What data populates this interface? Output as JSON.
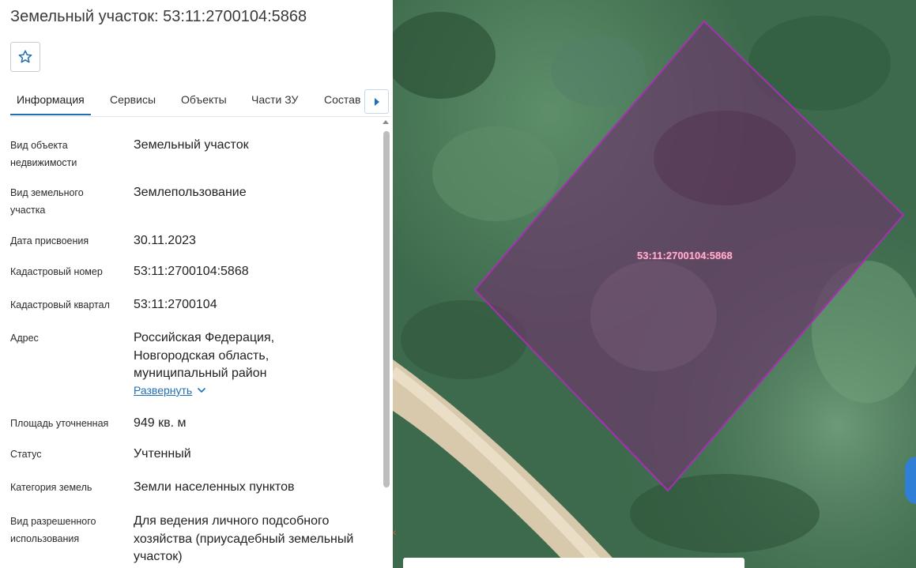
{
  "title": "Земельный участок: 53:11:2700104:5868",
  "favorite_icon": "star-outline-icon",
  "tabs": [
    {
      "label": "Информация",
      "active": true
    },
    {
      "label": "Сервисы"
    },
    {
      "label": "Объекты"
    },
    {
      "label": "Части ЗУ"
    },
    {
      "label": "Состав"
    }
  ],
  "tab_next_icon": "triangle-right-icon",
  "info": [
    {
      "label": "Вид объекта недвижимости",
      "value": "Земельный участок"
    },
    {
      "label": "Вид земельного участка",
      "value": "Землепользование"
    },
    {
      "label": "Дата присвоения",
      "value": "30.11.2023"
    },
    {
      "label": "Кадастровый номер",
      "value": "53:11:2700104:5868"
    },
    {
      "label": "Кадастровый квартал",
      "value": "53:11:2700104"
    },
    {
      "label": "Адрес",
      "value": "Российская Федерация, Новгородская область, муниципальный район",
      "expand": "Развернуть"
    },
    {
      "label": "Площадь уточненная",
      "value": "949 кв. м"
    },
    {
      "label": "Статус",
      "value": "Учтенный"
    },
    {
      "label": "Категория земель",
      "value": "Земли населенных пунктов"
    },
    {
      "label": "Вид разрешенного использования",
      "value": "Для ведения личного подсобного хозяйства (приусадебный земельный участок)"
    }
  ],
  "map": {
    "parcel_label": "53:11:2700104:5868",
    "colors": {
      "parcel_stroke": "#a432b0",
      "parcel_fill": "#6a3a6a",
      "accent": "#1f6fb5"
    }
  }
}
